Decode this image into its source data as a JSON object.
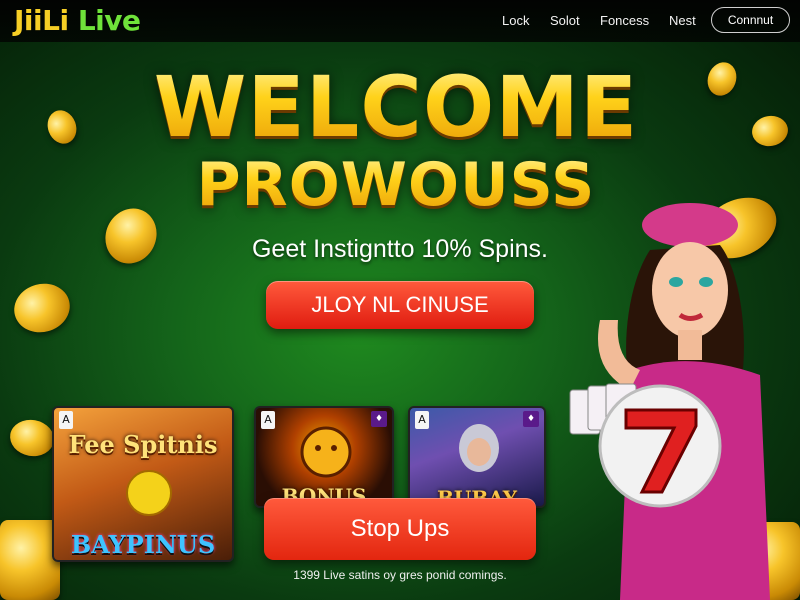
{
  "brand": {
    "logo_part1": "JiiLi",
    "logo_part2": "Live"
  },
  "nav": {
    "items": [
      "Lock",
      "Solot",
      "Foncess",
      "Nest"
    ],
    "connect_label": "Connnut"
  },
  "hero": {
    "headline_line1": "WELCOME",
    "headline_line2": "PROWOUSS",
    "subtitle": "Geet Instigntto 10% Spins.",
    "cta_label": "JLOY NL CINUSE"
  },
  "games": [
    {
      "title_top": "Fee Spitnis",
      "title_bottom": "BAYPINUS",
      "suit": "A"
    },
    {
      "title": "BONUS",
      "suit": "A"
    },
    {
      "title": "BUBAY",
      "suit": "A"
    }
  ],
  "stop_button_label": "Stop Ups",
  "footer_text": "1399 Live satins oy gres ponid comings.",
  "icons": {
    "seven": "lucky-seven-ball-icon",
    "coin": "gold-coin-icon",
    "card": "playing-card-icon"
  },
  "colors": {
    "accent_red": "#e3260f",
    "gold": "#ffd21a",
    "green_bg": "#14641a"
  }
}
